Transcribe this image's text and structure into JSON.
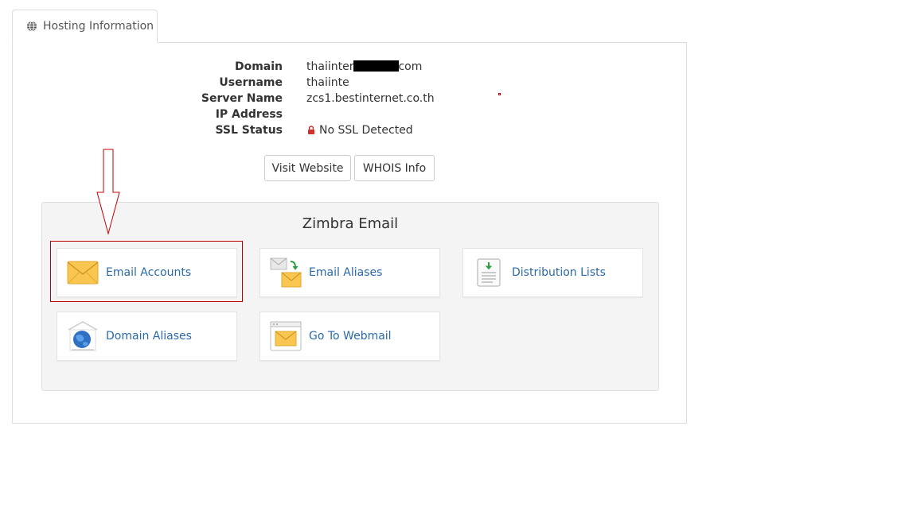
{
  "tab": {
    "label": "Hosting Information",
    "icon": "globe-icon"
  },
  "info": {
    "domain_label": "Domain",
    "domain_value_start": "thaiinter",
    "domain_value_end": "com",
    "username_label": "Username",
    "username_value": "thaiinte",
    "server_label": "Server Name",
    "server_value": "zcs1.bestinternet.co.th",
    "ip_label": "IP Address",
    "ip_value": "",
    "ssl_label": "SSL Status",
    "ssl_value": "No SSL Detected"
  },
  "buttons": {
    "visit": "Visit Website",
    "whois": "WHOIS Info"
  },
  "zimbra": {
    "title": "Zimbra Email",
    "cards": [
      {
        "label": "Email Accounts",
        "icon": "envelope-icon"
      },
      {
        "label": "Email Aliases",
        "icon": "email-aliases-icon"
      },
      {
        "label": "Distribution Lists",
        "icon": "distribution-list-icon"
      },
      {
        "label": "Domain Aliases",
        "icon": "globe-house-icon"
      },
      {
        "label": "Go To Webmail",
        "icon": "webmail-icon"
      }
    ]
  },
  "colors": {
    "link": "#2a6aa7",
    "highlight": "#c00000",
    "envelope": "#f9c74f"
  }
}
